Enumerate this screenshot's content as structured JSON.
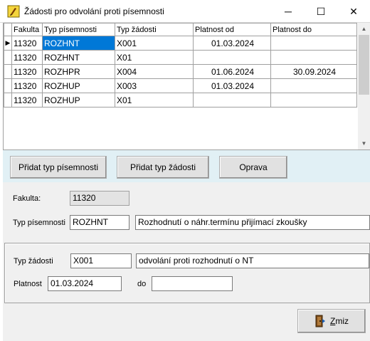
{
  "window": {
    "title": "Žádosti pro odvolání proti písemnosti",
    "minimize_glyph": "─",
    "maximize_glyph": "☐",
    "close_glyph": "✕"
  },
  "grid": {
    "columns": [
      "Fakulta",
      "Typ písemnosti",
      "Typ žádosti",
      "Platnost od",
      "Platnost do"
    ],
    "current_row_indicator": "▶",
    "rows": [
      {
        "fakulta": "11320",
        "typ_pisemnosti": "ROZHNT",
        "typ_zadosti": "X001",
        "platnost_od": "01.03.2024",
        "platnost_do": ""
      },
      {
        "fakulta": "11320",
        "typ_pisemnosti": "ROZHNT",
        "typ_zadosti": "X01",
        "platnost_od": "",
        "platnost_do": ""
      },
      {
        "fakulta": "11320",
        "typ_pisemnosti": "ROZHPR",
        "typ_zadosti": "X004",
        "platnost_od": "01.06.2024",
        "platnost_do": "30.09.2024"
      },
      {
        "fakulta": "11320",
        "typ_pisemnosti": "ROZHUP",
        "typ_zadosti": "X003",
        "platnost_od": "01.03.2024",
        "platnost_do": ""
      },
      {
        "fakulta": "11320",
        "typ_pisemnosti": "ROZHUP",
        "typ_zadosti": "X01",
        "platnost_od": "",
        "platnost_do": ""
      }
    ]
  },
  "buttons": {
    "add_document_type": "Přidat typ písemnosti",
    "add_request_type": "Přidat typ žádosti",
    "edit": "Oprava"
  },
  "form": {
    "fakulta_label": "Fakulta:",
    "fakulta_value": "11320",
    "typ_pisemnosti_label": "Typ písemnosti",
    "typ_pisemnosti_code": "ROZHNT",
    "typ_pisemnosti_desc": "Rozhodnutí o náhr.termínu přijímací zkoušky",
    "typ_zadosti_label": "Typ žádosti",
    "typ_zadosti_code": "X001",
    "typ_zadosti_desc": "odvolání proti rozhodnutí o NT",
    "platnost_label": "Platnost",
    "platnost_od": "01.03.2024",
    "do_label": "do",
    "platnost_do": ""
  },
  "cancel_button": {
    "mnemonic": "Z",
    "rest": "miz"
  }
}
